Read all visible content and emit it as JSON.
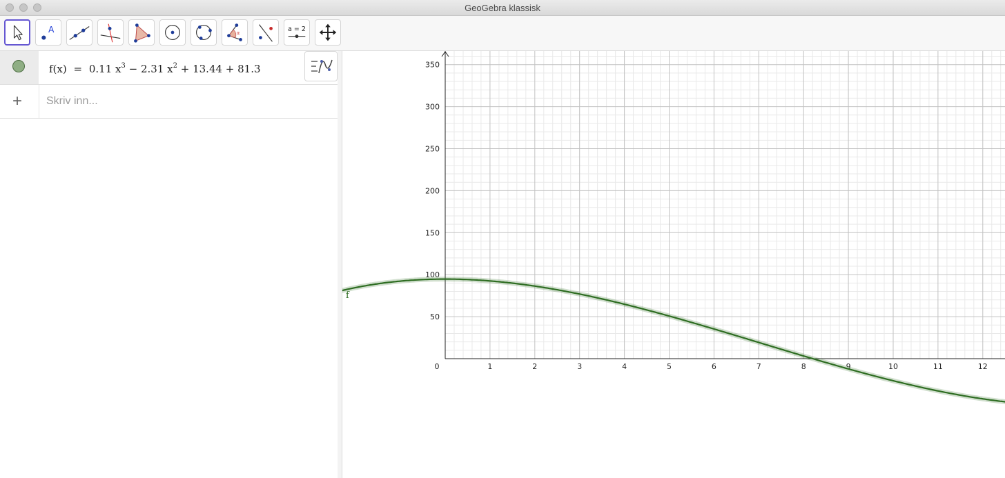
{
  "window": {
    "title": "GeoGebra klassisk"
  },
  "toolbar": {
    "tools": [
      {
        "name": "move-tool-button",
        "icon": "cursor-arrow-icon",
        "selected": true
      },
      {
        "name": "point-tool-button",
        "icon": "point-icon"
      },
      {
        "name": "line-tool-button",
        "icon": "line-icon"
      },
      {
        "name": "perpendicular-tool-button",
        "icon": "perpendicular-line-icon"
      },
      {
        "name": "polygon-tool-button",
        "icon": "polygon-icon"
      },
      {
        "name": "circle-tool-button",
        "icon": "circle-center-icon"
      },
      {
        "name": "conic-tool-button",
        "icon": "circle-three-points-icon"
      },
      {
        "name": "angle-tool-button",
        "icon": "angle-icon"
      },
      {
        "name": "reflect-tool-button",
        "icon": "reflect-icon"
      },
      {
        "name": "slider-tool-button",
        "icon": "slider-icon",
        "label": "a = 2"
      },
      {
        "name": "move-graphics-tool-button",
        "icon": "move-graphics-icon"
      }
    ]
  },
  "algebra": {
    "items": [
      {
        "lhs": "f(x)",
        "eq": "=",
        "terms": [
          {
            "text": "0.11 x",
            "sup": "3"
          },
          {
            "text": " − 2.31 x",
            "sup": "2"
          },
          {
            "text": " + 13.44 + 81.3",
            "sup": ""
          }
        ],
        "color": "#2e6d22"
      }
    ],
    "input_placeholder": "Skriv inn...",
    "input_value": ""
  },
  "graphics": {
    "function_label": "f",
    "x_ticks": [
      "0",
      "1",
      "2",
      "3",
      "4",
      "5",
      "6",
      "7",
      "8",
      "9",
      "10",
      "11",
      "12"
    ],
    "y_ticks": [
      "50",
      "100",
      "150",
      "200",
      "250",
      "300",
      "350"
    ],
    "curve_color": "#2e6d22",
    "coefficients": {
      "a": 0.11,
      "b": -2.31,
      "c": 0,
      "d": 94.74
    }
  }
}
